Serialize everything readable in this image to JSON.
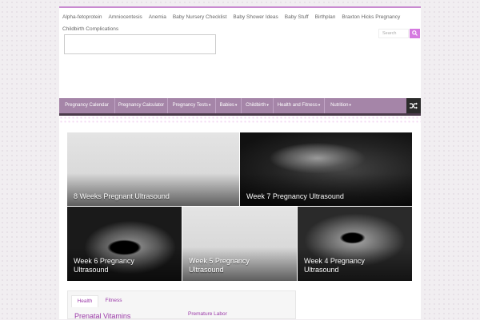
{
  "top_menu": [
    "Alpha-fetoprotein",
    "Amniocentesis",
    "Anemia",
    "Baby Nursery Checklist",
    "Baby Shower Ideas",
    "Baby Stuff",
    "Birthplan",
    "Braxton Hicks Pregnancy",
    "Childbirth Complications"
  ],
  "search": {
    "placeholder": "Search"
  },
  "main_nav": [
    {
      "label": "Pregnancy Calendar",
      "caret": ""
    },
    {
      "label": "Pregnancy Calculator",
      "caret": ""
    },
    {
      "label": "Pregnancy Tests",
      "caret": "▾"
    },
    {
      "label": "Babies",
      "caret": "▾"
    },
    {
      "label": "Childbirth",
      "caret": "▾"
    },
    {
      "label": "Health and Fitness",
      "caret": "▾"
    },
    {
      "label": "Nutrition",
      "caret": "▾"
    }
  ],
  "slides": [
    {
      "title": "8 Weeks Pregnant Ultrasound"
    },
    {
      "title": "Week 7 Pregnancy Ultrasound"
    },
    {
      "title": "Week 6 Pregnancy Ultrasound"
    },
    {
      "title": "Week 5 Pregnancy Ultrasound"
    },
    {
      "title": "Week 4 Pregnancy Ultrasound"
    }
  ],
  "tabs": [
    "Health",
    "Fitness"
  ],
  "post_title": "Prenatal Vitamins",
  "side_link": "Premature Labor",
  "colors": {
    "accent": "#9b3aa8",
    "nav_bg": "#a585a8",
    "top_line": "#c88ad0",
    "search_button": "#d57ae0"
  }
}
